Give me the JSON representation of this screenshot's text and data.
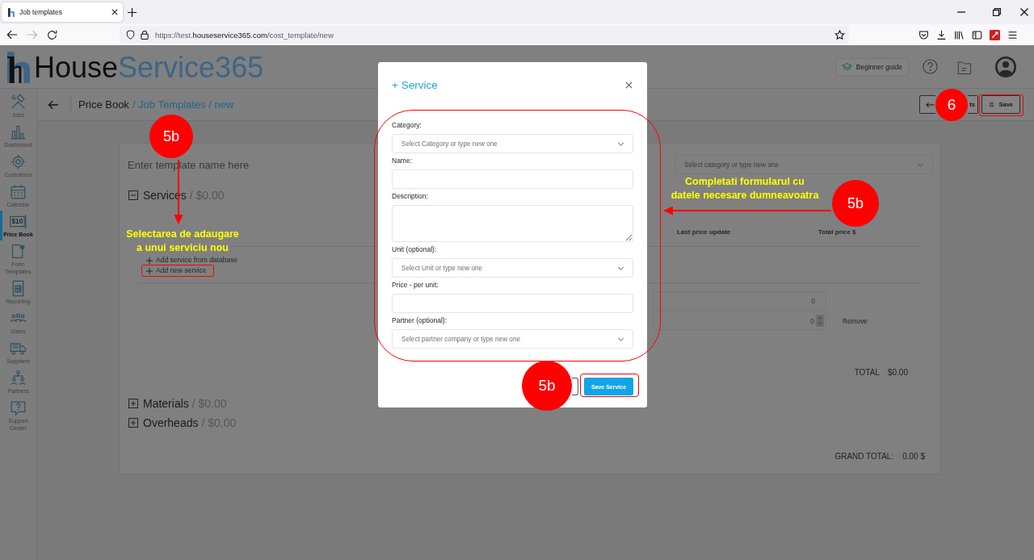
{
  "browser": {
    "tab_title": "Job templates",
    "nav": [
      {
        "kind": "back",
        "disabled": false
      },
      {
        "kind": "forward",
        "disabled": true
      },
      {
        "kind": "reload",
        "disabled": false
      }
    ],
    "url": {
      "prefix": "https://test.",
      "domain": "houseservice365.com",
      "path": "/cost_template/new"
    }
  },
  "header": {
    "logo": {
      "first": "House",
      "second": "Service365"
    },
    "guide_button": "Beginner guide"
  },
  "sidebar": {
    "items": [
      {
        "label": "Jobs",
        "selected": false
      },
      {
        "label": "Dashboard",
        "selected": false
      },
      {
        "label": "Customers",
        "selected": false
      },
      {
        "label": "Calendar",
        "selected": false
      },
      {
        "label": "Price Book",
        "selected": true,
        "icon_text": "$10"
      },
      {
        "label": "Form Templates",
        "selected": false
      },
      {
        "label": "Reporting",
        "selected": false
      },
      {
        "label": "Users",
        "selected": false
      },
      {
        "label": "Suppliers",
        "selected": false
      },
      {
        "label": "Partners",
        "selected": false
      },
      {
        "label": "Support Center",
        "selected": false
      }
    ]
  },
  "breadcrumb": {
    "root": "Price Book",
    "trail": "/ Job Templates / new"
  },
  "page_actions": {
    "back_button": "ts",
    "save_button": "Save"
  },
  "template": {
    "name_placeholder": "Enter template name here",
    "category_placeholder": "Select category or type new one",
    "sections": [
      {
        "title": "Services",
        "amount": "/ $0.00",
        "expanded": true
      },
      {
        "title": "Materials",
        "amount": "/ $0.00",
        "expanded": false
      },
      {
        "title": "Overheads",
        "amount": "/ $0.00",
        "expanded": false
      }
    ],
    "items_table": {
      "columns": [
        "Last price update",
        "Total price $"
      ],
      "add_links": [
        "Add service from database",
        "Add new service"
      ],
      "rows": [
        {
          "value": "0",
          "kind": "plain"
        },
        {
          "value": "0",
          "kind": "stepper",
          "action": "Remove"
        }
      ],
      "total": {
        "label": "TOTAL",
        "value": "$0.00"
      }
    },
    "grand_total": {
      "label": "GRAND TOTAL:",
      "value": "0.00 $"
    }
  },
  "dialog": {
    "title": "+ Service",
    "fields": [
      {
        "label": "Category:",
        "kind": "select",
        "placeholder": "Select Category or type new one"
      },
      {
        "label": "Name:",
        "kind": "text"
      },
      {
        "label": "Description:",
        "kind": "textarea"
      },
      {
        "label": "Unit (optional):",
        "kind": "select",
        "placeholder": "Select Unit or type new one"
      },
      {
        "label": "Price - per unit:",
        "kind": "text"
      },
      {
        "label": "Partner (optional):",
        "kind": "select",
        "placeholder": "Select partner company or type new one"
      }
    ],
    "save_button": "Save Service"
  },
  "annotations": {
    "badges": [
      "5b",
      "5b",
      "5b",
      "6"
    ],
    "notes": [
      {
        "lines": [
          "Selectarea de adaugare",
          "a unui serviciu nou"
        ]
      },
      {
        "lines": [
          "Completati formularul cu",
          "datele necesare dumneavoatra"
        ]
      }
    ]
  }
}
